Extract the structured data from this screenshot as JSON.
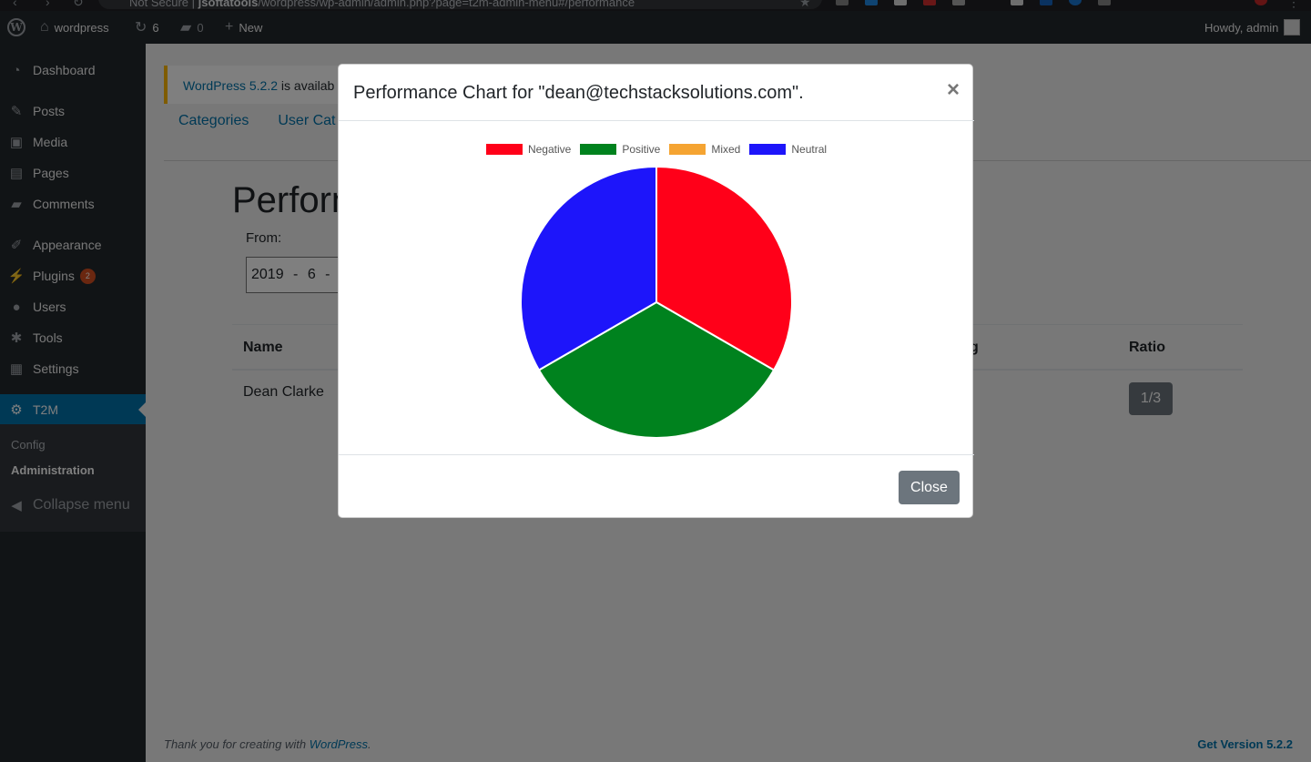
{
  "browser": {
    "security_label": "Not Secure",
    "host": "jsoftatools",
    "path": "/wordpress/wp-admin/admin.php?page=t2m-admin-menu#/performance"
  },
  "adminbar": {
    "site_name": "wordpress",
    "updates_count": "6",
    "comments_count": "0",
    "new_label": "New",
    "howdy": "Howdy, admin"
  },
  "sidebar": {
    "items": [
      {
        "label": "Dashboard",
        "icon": "dashboard-icon"
      },
      {
        "label": "Posts",
        "icon": "pin-icon"
      },
      {
        "label": "Media",
        "icon": "media-icon"
      },
      {
        "label": "Pages",
        "icon": "pages-icon"
      },
      {
        "label": "Comments",
        "icon": "comment-icon"
      },
      {
        "label": "Appearance",
        "icon": "brush-icon"
      },
      {
        "label": "Plugins",
        "icon": "plugin-icon",
        "badge": "2"
      },
      {
        "label": "Users",
        "icon": "user-icon"
      },
      {
        "label": "Tools",
        "icon": "wrench-icon"
      },
      {
        "label": "Settings",
        "icon": "settings-icon"
      },
      {
        "label": "T2M",
        "icon": "gear-icon"
      }
    ],
    "submenu": [
      "Config",
      "Administration"
    ],
    "collapse_label": "Collapse menu"
  },
  "notice": {
    "link_text": "WordPress 5.2.2",
    "text": " is availab"
  },
  "tabs": [
    "Categories",
    "User Cat"
  ],
  "page": {
    "title": "Perforn",
    "from_label": "From:",
    "from_value": "2019 - 6 - 14"
  },
  "table": {
    "headers": {
      "name": "Name",
      "partial": "g",
      "ratio": "Ratio"
    },
    "rows": [
      {
        "name": "Dean Clarke",
        "ratio": "1/3"
      }
    ]
  },
  "footer": {
    "thanks_prefix": "Thank you for creating with ",
    "thanks_link": "WordPress",
    "thanks_suffix": ".",
    "version": "Get Version 5.2.2"
  },
  "modal": {
    "title": "Performance Chart for \"dean@techstacksolutions.com\".",
    "close_x": "×",
    "close_button": "Close"
  },
  "chart_data": {
    "type": "pie",
    "title": "",
    "categories": [
      "Negative",
      "Positive",
      "Mixed",
      "Neutral"
    ],
    "values": [
      1,
      1,
      0,
      1
    ],
    "colors": [
      "#ff0019",
      "#00821e",
      "#f5a432",
      "#1d15fa"
    ],
    "legend_position": "top"
  }
}
